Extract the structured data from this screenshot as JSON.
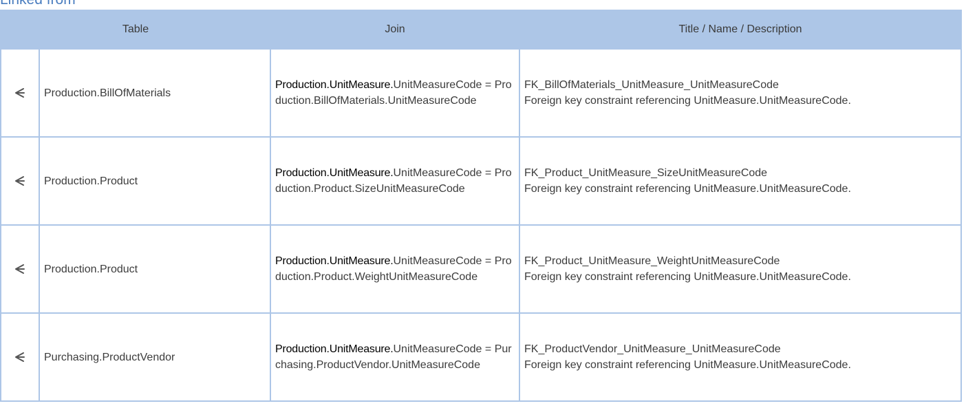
{
  "section": {
    "title": "Linked from"
  },
  "table": {
    "headers": {
      "table": "Table",
      "join": "Join",
      "title": "Title / Name / Description"
    },
    "rows": [
      {
        "icon": "arrow-left-icon",
        "table_name": "Production.BillOfMaterials",
        "join_source": "Production.UnitMeasure.",
        "join_rest": "UnitMeasureCode = Production.BillOfMaterials.UnitMeasureCode",
        "fk_name": "FK_BillOfMaterials_UnitMeasure_UnitMeasureCode",
        "description": "Foreign key constraint referencing UnitMeasure.UnitMeasureCode."
      },
      {
        "icon": "arrow-left-icon",
        "table_name": "Production.Product",
        "join_source": "Production.UnitMeasure.",
        "join_rest": "UnitMeasureCode = Production.Product.SizeUnitMeasureCode",
        "fk_name": "FK_Product_UnitMeasure_SizeUnitMeasureCode",
        "description": "Foreign key constraint referencing UnitMeasure.UnitMeasureCode."
      },
      {
        "icon": "arrow-left-icon",
        "table_name": "Production.Product",
        "join_source": "Production.UnitMeasure.",
        "join_rest": "UnitMeasureCode = Production.Product.WeightUnitMeasureCode",
        "fk_name": "FK_Product_UnitMeasure_WeightUnitMeasureCode",
        "description": "Foreign key constraint referencing UnitMeasure.UnitMeasureCode."
      },
      {
        "icon": "arrow-left-icon",
        "table_name": "Purchasing.ProductVendor",
        "join_source": "Production.UnitMeasure.",
        "join_rest": "UnitMeasureCode = Purchasing.ProductVendor.UnitMeasureCode",
        "fk_name": "FK_ProductVendor_UnitMeasure_UnitMeasureCode",
        "description": "Foreign key constraint referencing UnitMeasure.UnitMeasureCode."
      }
    ]
  },
  "colors": {
    "header_bg": "#adc6e7",
    "border": "#adc6e7",
    "title": "#4a7dbf"
  }
}
